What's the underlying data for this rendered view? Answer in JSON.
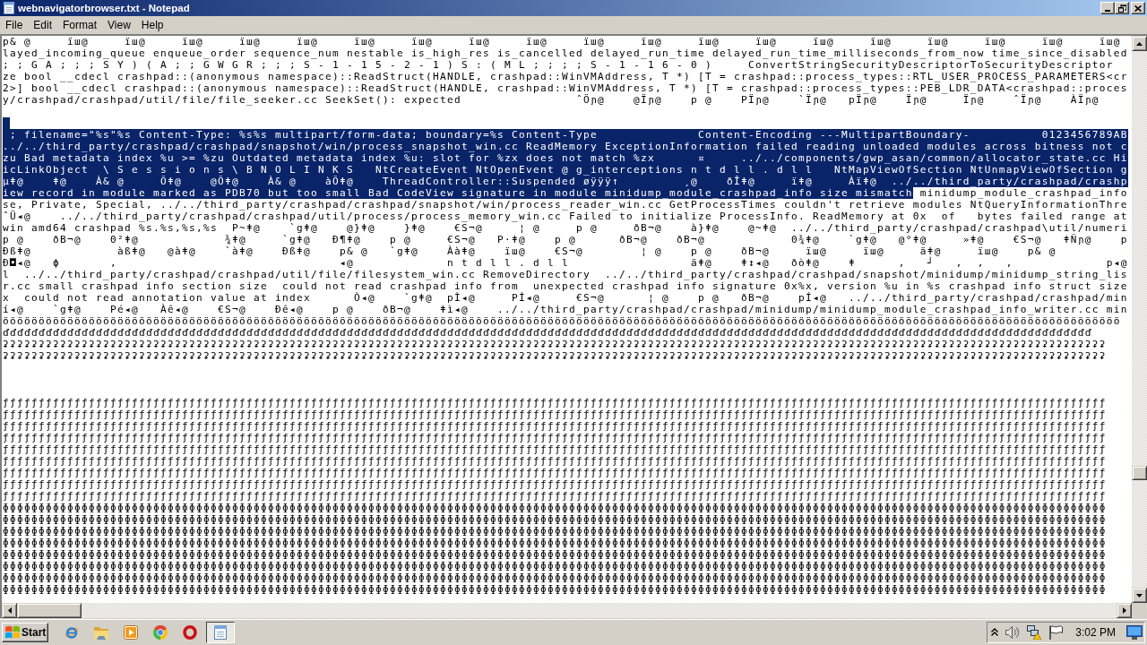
{
  "window": {
    "title": "webnavigatorbrowser.txt - Notepad"
  },
  "menu": [
    "File",
    "Edit",
    "Format",
    "View",
    "Help"
  ],
  "editor": {
    "lines": [
      {
        "kind": "text",
        "segments": [
          {
            "text": "p& @     ïш@     ïш@     ïш@     ïш@     ïш@     ïш@     ïш@     ïш@     ïш@     ïш@     ïш@     ïш@     ïш@     ïш@     ïш@     ïш@     ïш@     ïш@     ïш@",
            "selected": false
          }
        ]
      },
      {
        "kind": "text",
        "segments": [
          {
            "text": "layed_incoming_queue enqueue_order sequence_num nestable is_high_res is_cancelled delayed_run_time delayed_run_time_milliseconds_from_now time_since_disabled",
            "selected": false
          }
        ]
      },
      {
        "kind": "text",
        "segments": [
          {
            "text": "; ; G A ; ; ; S Y ) ( A ; ; G W G R ; ; ; S - 1 - 1 5 - 2 - 1 ) S : ( M L ; ; ; ; S - 1 - 1 6 - 0 )     ConvertStringSecurityDescriptorToSecurityDescriptor",
            "selected": false
          }
        ]
      },
      {
        "kind": "text",
        "segments": [
          {
            "text": "ze bool __cdecl crashpad::(anonymous namespace)::ReadStruct(HANDLE, crashpad::WinVMAddress, T *) [T = crashpad::process_types::RTL_USER_PROCESS_PARAMETERS<cr",
            "selected": false
          }
        ]
      },
      {
        "kind": "text",
        "segments": [
          {
            "text": "2>] bool __cdecl crashpad::(anonymous namespace)::ReadStruct(HANDLE, crashpad::WinVMAddress, T *) [T = crashpad::process_types::PEB_LDR_DATA<crashpad::proces",
            "selected": false
          }
        ]
      },
      {
        "kind": "text",
        "segments": [
          {
            "text": "y/crashpad/crashpad/util/file/file_seeker.cc SeekSet(): expected                ˆÖɲ@    @Ïɲ@    p @    PÏɲ@    `Ïɲ@   pÏɲ@    Ïɲ@     Ïɲ@    ˆÏɲ@    ÀÏɲ@",
            "selected": false
          }
        ]
      },
      {
        "kind": "blank",
        "selected": false
      },
      {
        "kind": "blank",
        "selected": true
      },
      {
        "kind": "text",
        "segments": [
          {
            "text": " ; filename=\"%s\"%s Content-Type: %s%s multipart/form-data; boundary=%s Content-Type              Content-Encoding ---MultipartBoundary-          0123456789AB",
            "selected": true
          }
        ]
      },
      {
        "kind": "text",
        "segments": [
          {
            "text": "../../third_party/crashpad/crashpad/snapshot/win/process_snapshot_win.cc ReadMemory ExceptionInformation failed reading unloaded modules across bitness not c",
            "selected": true
          }
        ]
      },
      {
        "kind": "text",
        "segments": [
          {
            "text": "zu Bad metadata index %u >= %zu Outdated metadata index %u: slot for %zx does not match %zx      ¤     ../../components/gwp_asan/common/allocator_state.cc Hi",
            "selected": true
          }
        ]
      },
      {
        "kind": "text",
        "segments": [
          {
            "text": "icLinkObject  \\ S e s s i o n s \\ B N O L I N K S   NtCreateEvent NtOpenEvent @ g_interceptions n t d l l . d l l   NtMapViewOfSection NtUnmapViewOfSection g",
            "selected": true
          }
        ]
      },
      {
        "kind": "text",
        "segments": [
          {
            "text": "µǂ@    ǂ@    À& @     Õǂ@    @Õǂ@    À& @    àÕǂ@    ThreadController::Suspended øÿÿÿ↑         ¸@    ðÎǂ@     ïǂ@     Àïǂ@  ../../third_party/crashpad/crashp",
            "selected": true
          }
        ]
      },
      {
        "kind": "text",
        "segments": [
          {
            "text": "iew record in module marked as PDB70 but too small Bad CodeView signature in module minidump_module_crashpad_info size mismatch",
            "selected": true
          },
          {
            "text": " minidump_module_crashpad_info",
            "selected": false
          }
        ]
      },
      {
        "kind": "text",
        "segments": [
          {
            "text": "se, Private, Special, ../../third_party/crashpad/crashpad/snapshot/win/process_reader_win.cc GetProcessTimes couldn't retrieve modules NtQueryInformationThre",
            "selected": false
          }
        ]
      },
      {
        "kind": "text",
        "segments": [
          {
            "text": "ˆÜ◂@    ../../third_party/crashpad/crashpad/util/process/process_memory_win.cc Failed to initialize ProcessInfo. ReadMemory at 0x  of   bytes failed range at",
            "selected": false
          }
        ]
      },
      {
        "kind": "text",
        "segments": [
          {
            "text": "win amd64 crashpad %s.%s,%s,%s  P~ǂ@    `gǂ@    @}ǂ@    }ǂ@    €S¬@     ¦ @     p @     ðB¬@    à}ǂ@    @~ǂ@  ../../third_party/crashpad/crashpad\\util/numeri",
            "selected": false
          }
        ]
      },
      {
        "kind": "text",
        "segments": [
          {
            "text": "p @    ðB¬@    0²ǂ@            ¾ǂ@     `gǂ@   Ð¶ǂ@    p @     €S¬@   P·ǂ@    p @      ðB¬@    ðB¬@            0¾ǂ@    `gǂ@   @°ǂ@     »ǂ@    €S¬@   ǂÑɲ@    p",
            "selected": false
          }
        ]
      },
      {
        "kind": "text",
        "segments": [
          {
            "text": "Ðßǂ@            àßǂ@   @àǂ@    `àǂ@    Ðßǂ@    p& @   `gǂ@    Ààǂ@    ïш@    €S¬@        ¦ @    p @    ðB¬@     ïш@     ïш@     äǂ@     ïш@    p& @",
            "selected": false
          }
        ]
      },
      {
        "kind": "text",
        "segments": [
          {
            "text": "Ð◘◂@   ϕ       ,                               ◂@             n t d l l . d l l                 äǂ@    ǂ↕◂@   ðòǂ@    ǂ      ,   ┘   ,  ,   ,             p◂@",
            "selected": false
          }
        ]
      },
      {
        "kind": "text",
        "segments": [
          {
            "text": "l  ../../third_party/crashpad/crashpad/util/file/filesystem_win.cc RemoveDirectory  ../../third_party/crashpad/crashpad/snapshot/minidump/minidump_string_lis",
            "selected": false
          }
        ]
      },
      {
        "kind": "text",
        "segments": [
          {
            "text": "r.cc small crashpad info section size  could not read crashpad info from  unexpected crashpad info signature 0x%x, version %u in %s crashpad info struct size",
            "selected": false
          }
        ]
      },
      {
        "kind": "text",
        "segments": [
          {
            "text": "x  could not read annotation value at index      Ò◂@    `gǂ@  pÌ◂@     PÍ◂@     €S¬@      ¦ @    p @   ðB¬@    pÍ◂@   ../../third_party/crashpad/crashpad/min",
            "selected": false
          }
        ]
      },
      {
        "kind": "text",
        "segments": [
          {
            "text": "í◂@    `gǂ@    Pé◂@   Àê◂@    €S¬@    Ðê◂@    p @    ðB¬@    ǂì◂@    ../../third_party/crashpad/crashpad/minidump/minidump_module_crashpad_info_writer.cc min",
            "selected": false
          }
        ]
      },
      {
        "kind": "text",
        "segments": [
          {
            "text": "öööööööööööööööööööööööööööööööööööööööööööööööööööööööööööööööööööööööööööööööööööööööööööööööööööööööööööööööööööööööööööööööööööööööööööööööööööööööööööö",
            "selected": false
          }
        ]
      },
      {
        "kind": "text",
        "segments": [
          {
            "text": "ďďďďďďďďďďďďďďďďďďďďďďďďďďďďďďďďďďďďďďďďďďďďďďďďďďďďďďďďďďďďďďďďďďďďďďďďďďďďďďďďďďďďďďďďďďďďďďďďďďďďďďďďďďďďďďďďďďďďďďďďďďďďďďďďďďďďďďďďďďďďďďďďďďďďďďďď",
            "selected": false
          }
        ]
      },
      {
        "kind": "text",
        "segments": [
          {
            "text": "ʡʡʡʡʡʡʡʡʡʡʡʡʡʡʡʡʡʡʡʡʡʡʡʡʡʡʡʡʡʡʡʡʡʡʡʡʡʡʡʡʡʡʡʡʡʡʡʡʡʡʡʡʡʡʡʡʡʡʡʡʡʡʡʡʡʡʡʡʡʡʡʡʡʡʡʡʡʡʡʡʡʡʡʡʡʡʡʡʡʡʡʡʡʡʡʡʡʡʡʡʡʡʡʡʡʡʡʡʡʡʡʡʡʡʡʡʡʡʡʡʡʡʡʡʡʡʡʡʡʡʡʡʡʡʡʡʡʡʡʡʡʡʡʡʡʡʡʡʡʡʡʡʡʡ",
            "selected": false
          }
        ]
      },
      {
        "kind": "text",
        "segments": [
          {
            "text": "ʡʡʡʡʡʡʡʡʡʡʡʡʡʡʡʡʡʡʡʡʡʡʡʡʡʡʡʡʡʡʡʡʡʡʡʡʡʡʡʡʡʡʡʡʡʡʡʡʡʡʡʡʡʡʡʡʡʡʡʡʡʡʡʡʡʡʡʡʡʡʡʡʡʡʡʡʡʡʡʡʡʡʡʡʡʡʡʡʡʡʡʡʡʡʡʡʡʡʡʡʡʡʡʡʡʡʡʡʡʡʡʡʡʡʡʡʡʡʡʡʡʡʡʡʡʡʡʡʡʡʡʡʡʡʡʡʡʡʡʡʡʡʡʡʡʡʡʡʡʡʡʡʡʡ",
            "selected": false
          }
        ]
      },
      {
        "kind": "blank",
        "selected": false
      },
      {
        "kind": "blank",
        "selected": false
      },
      {
        "kind": "blank",
        "selected": false
      },
      {
        "kind": "text",
        "segments": [
          {
            "text": "ƒƒƒƒƒƒƒƒƒƒƒƒƒƒƒƒƒƒƒƒƒƒƒƒƒƒƒƒƒƒƒƒƒƒƒƒƒƒƒƒƒƒƒƒƒƒƒƒƒƒƒƒƒƒƒƒƒƒƒƒƒƒƒƒƒƒƒƒƒƒƒƒƒƒƒƒƒƒƒƒƒƒƒƒƒƒƒƒƒƒƒƒƒƒƒƒƒƒƒƒƒƒƒƒƒƒƒƒƒƒƒƒƒƒƒƒƒƒƒƒƒƒƒƒƒƒƒƒƒƒƒƒƒƒƒƒƒƒƒƒƒƒƒƒƒƒƒƒƒƒƒƒƒƒ",
            "selected": false
          }
        ]
      },
      {
        "kind": "text",
        "segments": [
          {
            "text": "ƒƒƒƒƒƒƒƒƒƒƒƒƒƒƒƒƒƒƒƒƒƒƒƒƒƒƒƒƒƒƒƒƒƒƒƒƒƒƒƒƒƒƒƒƒƒƒƒƒƒƒƒƒƒƒƒƒƒƒƒƒƒƒƒƒƒƒƒƒƒƒƒƒƒƒƒƒƒƒƒƒƒƒƒƒƒƒƒƒƒƒƒƒƒƒƒƒƒƒƒƒƒƒƒƒƒƒƒƒƒƒƒƒƒƒƒƒƒƒƒƒƒƒƒƒƒƒƒƒƒƒƒƒƒƒƒƒƒƒƒƒƒƒƒƒƒƒƒƒƒƒƒƒƒ",
            "selected": false
          }
        ]
      },
      {
        "kind": "text",
        "segments": [
          {
            "text": "ƒƒƒƒƒƒƒƒƒƒƒƒƒƒƒƒƒƒƒƒƒƒƒƒƒƒƒƒƒƒƒƒƒƒƒƒƒƒƒƒƒƒƒƒƒƒƒƒƒƒƒƒƒƒƒƒƒƒƒƒƒƒƒƒƒƒƒƒƒƒƒƒƒƒƒƒƒƒƒƒƒƒƒƒƒƒƒƒƒƒƒƒƒƒƒƒƒƒƒƒƒƒƒƒƒƒƒƒƒƒƒƒƒƒƒƒƒƒƒƒƒƒƒƒƒƒƒƒƒƒƒƒƒƒƒƒƒƒƒƒƒƒƒƒƒƒƒƒƒƒƒƒƒƒ",
            "selected": false
          }
        ]
      },
      {
        "kind": "text",
        "segments": [
          {
            "text": "ƒƒƒƒƒƒƒƒƒƒƒƒƒƒƒƒƒƒƒƒƒƒƒƒƒƒƒƒƒƒƒƒƒƒƒƒƒƒƒƒƒƒƒƒƒƒƒƒƒƒƒƒƒƒƒƒƒƒƒƒƒƒƒƒƒƒƒƒƒƒƒƒƒƒƒƒƒƒƒƒƒƒƒƒƒƒƒƒƒƒƒƒƒƒƒƒƒƒƒƒƒƒƒƒƒƒƒƒƒƒƒƒƒƒƒƒƒƒƒƒƒƒƒƒƒƒƒƒƒƒƒƒƒƒƒƒƒƒƒƒƒƒƒƒƒƒƒƒƒƒƒƒƒƒ",
            "selected": false
          }
        ]
      },
      {
        "kind": "text",
        "segments": [
          {
            "text": "ƒƒƒƒƒƒƒƒƒƒƒƒƒƒƒƒƒƒƒƒƒƒƒƒƒƒƒƒƒƒƒƒƒƒƒƒƒƒƒƒƒƒƒƒƒƒƒƒƒƒƒƒƒƒƒƒƒƒƒƒƒƒƒƒƒƒƒƒƒƒƒƒƒƒƒƒƒƒƒƒƒƒƒƒƒƒƒƒƒƒƒƒƒƒƒƒƒƒƒƒƒƒƒƒƒƒƒƒƒƒƒƒƒƒƒƒƒƒƒƒƒƒƒƒƒƒƒƒƒƒƒƒƒƒƒƒƒƒƒƒƒƒƒƒƒƒƒƒƒƒƒƒƒƒ",
            "selected": false
          }
        ]
      },
      {
        "kind": "text",
        "segments": [
          {
            "text": "ƒƒƒƒƒƒƒƒƒƒƒƒƒƒƒƒƒƒƒƒƒƒƒƒƒƒƒƒƒƒƒƒƒƒƒƒƒƒƒƒƒƒƒƒƒƒƒƒƒƒƒƒƒƒƒƒƒƒƒƒƒƒƒƒƒƒƒƒƒƒƒƒƒƒƒƒƒƒƒƒƒƒƒƒƒƒƒƒƒƒƒƒƒƒƒƒƒƒƒƒƒƒƒƒƒƒƒƒƒƒƒƒƒƒƒƒƒƒƒƒƒƒƒƒƒƒƒƒƒƒƒƒƒƒƒƒƒƒƒƒƒƒƒƒƒƒƒƒƒƒƒƒƒƒ",
            "selected": false
          }
        ]
      },
      {
        "kind": "text",
        "segments": [
          {
            "text": "ƒƒƒƒƒƒƒƒƒƒƒƒƒƒƒƒƒƒƒƒƒƒƒƒƒƒƒƒƒƒƒƒƒƒƒƒƒƒƒƒƒƒƒƒƒƒƒƒƒƒƒƒƒƒƒƒƒƒƒƒƒƒƒƒƒƒƒƒƒƒƒƒƒƒƒƒƒƒƒƒƒƒƒƒƒƒƒƒƒƒƒƒƒƒƒƒƒƒƒƒƒƒƒƒƒƒƒƒƒƒƒƒƒƒƒƒƒƒƒƒƒƒƒƒƒƒƒƒƒƒƒƒƒƒƒƒƒƒƒƒƒƒƒƒƒƒƒƒƒƒƒƒƒƒ",
            "selected": false
          }
        ]
      },
      {
        "kind": "text",
        "segments": [
          {
            "text": "ƒƒƒƒƒƒƒƒƒƒƒƒƒƒƒƒƒƒƒƒƒƒƒƒƒƒƒƒƒƒƒƒƒƒƒƒƒƒƒƒƒƒƒƒƒƒƒƒƒƒƒƒƒƒƒƒƒƒƒƒƒƒƒƒƒƒƒƒƒƒƒƒƒƒƒƒƒƒƒƒƒƒƒƒƒƒƒƒƒƒƒƒƒƒƒƒƒƒƒƒƒƒƒƒƒƒƒƒƒƒƒƒƒƒƒƒƒƒƒƒƒƒƒƒƒƒƒƒƒƒƒƒƒƒƒƒƒƒƒƒƒƒƒƒƒƒƒƒƒƒƒƒƒƒ",
            "selected": false
          }
        ]
      },
      {
        "kind": "text",
        "segments": [
          {
            "text": "ƒƒƒƒƒƒƒƒƒƒƒƒƒƒƒƒƒƒƒƒƒƒƒƒƒƒƒƒƒƒƒƒƒƒƒƒƒƒƒƒƒƒƒƒƒƒƒƒƒƒƒƒƒƒƒƒƒƒƒƒƒƒƒƒƒƒƒƒƒƒƒƒƒƒƒƒƒƒƒƒƒƒƒƒƒƒƒƒƒƒƒƒƒƒƒƒƒƒƒƒƒƒƒƒƒƒƒƒƒƒƒƒƒƒƒƒƒƒƒƒƒƒƒƒƒƒƒƒƒƒƒƒƒƒƒƒƒƒƒƒƒƒƒƒƒƒƒƒƒƒƒƒƒƒ",
            "selected": false
          }
        ]
      },
      {
        "kind": "text",
        "segments": [
          {
            "text": "ɸɸɸɸɸɸɸɸɸɸɸɸɸɸɸɸɸɸɸɸɸɸɸɸɸɸɸɸɸɸɸɸɸɸɸɸɸɸɸɸɸɸɸɸɸɸɸɸɸɸɸɸɸɸɸɸɸɸɸɸɸɸɸɸɸɸɸɸɸɸɸɸɸɸɸɸɸɸɸɸɸɸɸɸɸɸɸɸɸɸɸɸɸɸɸɸɸɸɸɸɸɸɸɸɸɸɸɸɸɸɸɸɸɸɸɸɸɸɸɸɸɸɸɸɸɸɸɸɸɸɸɸɸɸɸɸɸɸɸɸɸɸɸɸɸɸɸɸɸɸɸɸɸɸ",
            "selected": false
          }
        ]
      },
      {
        "kind": "text",
        "segments": [
          {
            "text": "ɸɸɸɸɸɸɸɸɸɸɸɸɸɸɸɸɸɸɸɸɸɸɸɸɸɸɸɸɸɸɸɸɸɸɸɸɸɸɸɸɸɸɸɸɸɸɸɸɸɸɸɸɸɸɸɸɸɸɸɸɸɸɸɸɸɸɸɸɸɸɸɸɸɸɸɸɸɸɸɸɸɸɸɸɸɸɸɸɸɸɸɸɸɸɸɸɸɸɸɸɸɸɸɸɸɸɸɸɸɸɸɸɸɸɸɸɸɸɸɸɸɸɸɸɸɸɸɸɸɸɸɸɸɸɸɸɸɸɸɸɸɸɸɸɸɸɸɸɸɸɸɸɸɸ",
            "selected": false
          }
        ]
      },
      {
        "kind": "text",
        "segments": [
          {
            "text": "ɸɸɸɸɸɸɸɸɸɸɸɸɸɸɸɸɸɸɸɸɸɸɸɸɸɸɸɸɸɸɸɸɸɸɸɸɸɸɸɸɸɸɸɸɸɸɸɸɸɸɸɸɸɸɸɸɸɸɸɸɸɸɸɸɸɸɸɸɸɸɸɸɸɸɸɸɸɸɸɸɸɸɸɸɸɸɸɸɸɸɸɸɸɸɸɸɸɸɸɸɸɸɸɸɸɸɸɸɸɸɸɸɸɸɸɸɸɸɸɸɸɸɸɸɸɸɸɸɸɸɸɸɸɸɸɸɸɸɸɸɸɸɸɸɸɸɸɸɸɸɸɸɸɸ",
            "selected": false
          }
        ]
      },
      {
        "kind": "text",
        "segments": [
          {
            "text": "ɸɸɸɸɸɸɸɸɸɸɸɸɸɸɸɸɸɸɸɸɸɸɸɸɸɸɸɸɸɸɸɸɸɸɸɸɸɸɸɸɸɸɸɸɸɸɸɸɸɸɸɸɸɸɸɸɸɸɸɸɸɸɸɸɸɸɸɸɸɸɸɸɸɸɸɸɸɸɸɸɸɸɸɸɸɸɸɸɸɸɸɸɸɸɸɸɸɸɸɸɸɸɸɸɸɸɸɸɸɸɸɸɸɸɸɸɸɸɸɸɸɸɸɸɸɸɸɸɸɸɸɸɸɸɸɸɸɸɸɸɸɸɸɸɸɸɸɸɸɸɸɸɸɸ",
            "selected": false
          }
        ]
      },
      {
        "kind": "text",
        "segments": [
          {
            "text": "ɸɸɸɸɸɸɸɸɸɸɸɸɸɸɸɸɸɸɸɸɸɸɸɸɸɸɸɸɸɸɸɸɸɸɸɸɸɸɸɸɸɸɸɸɸɸɸɸɸɸɸɸɸɸɸɸɸɸɸɸɸɸɸɸɸɸɸɸɸɸɸɸɸɸɸɸɸɸɸɸɸɸɸɸɸɸɸɸɸɸɸɸɸɸɸɸɸɸɸɸɸɸɸɸɸɸɸɸɸɸɸɸɸɸɸɸɸɸɸɸɸɸɸɸɸɸɸɸɸɸɸɸɸɸɸɸɸɸɸɸɸɸɸɸɸɸɸɸɸɸɸɸɸɸ",
            "selected": false
          }
        ]
      },
      {
        "kind": "text",
        "segments": [
          {
            "text": "ɸɸɸɸɸɸɸɸɸɸɸɸɸɸɸɸɸɸɸɸɸɸɸɸɸɸɸɸɸɸɸɸɸɸɸɸɸɸɸɸɸɸɸɸɸɸɸɸɸɸɸɸɸɸɸɸɸɸɸɸɸɸɸɸɸɸɸɸɸɸɸɸɸɸɸɸɸɸɸɸɸɸɸɸɸɸɸɸɸɸɸɸɸɸɸɸɸɸɸɸɸɸɸɸɸɸɸɸɸɸɸɸɸɸɸɸɸɸɸɸɸɸɸɸɸɸɸɸɸɸɸɸɸɸɸɸɸɸɸɸɸɸɸɸɸɸɸɸɸɸɸɸɸɸ",
            "selected": false
          }
        ]
      },
      {
        "kind": "text",
        "segments": [
          {
            "text": "ɸɸɸɸɸɸɸɸɸɸɸɸɸɸɸɸɸɸɸɸɸɸɸɸɸɸɸɸɸɸɸɸɸɸɸɸɸɸɸɸɸɸɸɸɸɸɸɸɸɸɸɸɸɸɸɸɸɸɸɸɸɸɸɸɸɸɸɸɸɸɸɸɸɸɸɸɸɸɸɸɸɸɸɸɸɸɸɸɸɸɸɸɸɸɸɸɸɸɸɸɸɸɸɸɸɸɸɸɸɸɸɸɸɸɸɸɸɸɸɸɸɸɸɸɸɸɸɸɸɸɸɸɸɸɸɸɸɸɸɸɸɸɸɸɸɸɸɸɸɸɸɸɸɸ",
            "selected": false
          }
        ]
      },
      {
        "kind": "text",
        "segments": [
          {
            "text": "ɸɸɸɸɸɸɸɸɸɸɸɸɸɸɸɸɸɸɸɸɸɸɸɸɸɸɸɸɸɸɸɸɸɸɸɸɸɸɸɸɸɸɸɸɸɸɸɸɸɸɸɸɸɸɸɸɸɸɸɸɸɸɸɸɸɸɸɸɸɸɸɸɸɸɸɸɸɸɸɸɸɸɸɸɸɸɸɸɸɸɸɸɸɸɸɸɸɸɸɸɸɸɸɸɸɸɸɸɸɸɸɸɸɸɸɸɸɸɸɸɸɸɸɸɸɸɸɸɸɸɸɸɸɸɸɸɸɸɸɸɸɸɸɸɸɸɸɸɸɸɸɸɸɸ",
            "selected": false
          }
        ]
      }
    ]
  },
  "taskbar": {
    "start_label": "Start",
    "windows": [
      {
        "selected": true
      }
    ],
    "clock": "3:02 PM"
  }
}
